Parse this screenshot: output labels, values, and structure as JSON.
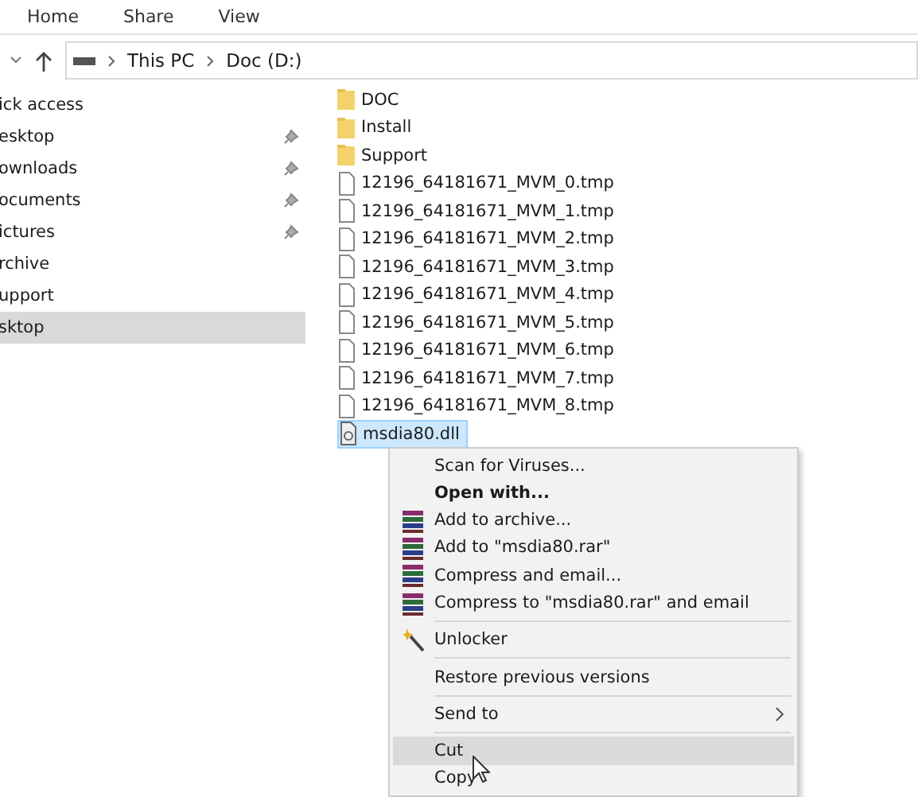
{
  "ribbon": {
    "tabs": [
      {
        "label": "Home",
        "selected": false
      },
      {
        "label": "Share",
        "selected": false
      },
      {
        "label": "View",
        "selected": false
      }
    ]
  },
  "address_bar": {
    "path": [
      "This PC",
      "Doc (D:)"
    ]
  },
  "navigation": {
    "items": [
      {
        "label": "ick access",
        "pinned": false,
        "selected": false
      },
      {
        "label": "esktop",
        "pinned": true,
        "selected": false
      },
      {
        "label": "ownloads",
        "pinned": true,
        "selected": false
      },
      {
        "label": "ocuments",
        "pinned": true,
        "selected": false
      },
      {
        "label": "ictures",
        "pinned": true,
        "selected": false
      },
      {
        "label": "rchive",
        "pinned": false,
        "selected": false
      },
      {
        "label": "upport",
        "pinned": false,
        "selected": false
      },
      {
        "label": "sktop",
        "pinned": false,
        "selected": true
      }
    ]
  },
  "files": [
    {
      "name": "DOC",
      "kind": "folder",
      "selected": false
    },
    {
      "name": "Install",
      "kind": "folder",
      "selected": false
    },
    {
      "name": "Support",
      "kind": "folder",
      "selected": false
    },
    {
      "name": "12196_64181671_MVM_0.tmp",
      "kind": "file",
      "selected": false
    },
    {
      "name": "12196_64181671_MVM_1.tmp",
      "kind": "file",
      "selected": false
    },
    {
      "name": "12196_64181671_MVM_2.tmp",
      "kind": "file",
      "selected": false
    },
    {
      "name": "12196_64181671_MVM_3.tmp",
      "kind": "file",
      "selected": false
    },
    {
      "name": "12196_64181671_MVM_4.tmp",
      "kind": "file",
      "selected": false
    },
    {
      "name": "12196_64181671_MVM_5.tmp",
      "kind": "file",
      "selected": false
    },
    {
      "name": "12196_64181671_MVM_6.tmp",
      "kind": "file",
      "selected": false
    },
    {
      "name": "12196_64181671_MVM_7.tmp",
      "kind": "file",
      "selected": false
    },
    {
      "name": "12196_64181671_MVM_8.tmp",
      "kind": "file",
      "selected": false
    },
    {
      "name": "msdia80.dll",
      "kind": "dll",
      "selected": true
    }
  ],
  "context_menu": {
    "items": [
      {
        "kind": "plain",
        "label": "Scan for Viruses...",
        "bold": false,
        "submenu": false,
        "selected": false
      },
      {
        "kind": "plain",
        "label": "Open with...",
        "bold": true,
        "submenu": false,
        "selected": false
      },
      {
        "kind": "archiver",
        "label": "Add to archive...",
        "bold": false,
        "submenu": false,
        "selected": false
      },
      {
        "kind": "archiver",
        "label": "Add to \"msdia80.rar\"",
        "bold": false,
        "submenu": false,
        "selected": false
      },
      {
        "kind": "archiver",
        "label": "Compress and email...",
        "bold": false,
        "submenu": false,
        "selected": false
      },
      {
        "kind": "archiver",
        "label": "Compress to \"msdia80.rar\" and email",
        "bold": false,
        "submenu": false,
        "selected": false
      },
      {
        "kind": "separator"
      },
      {
        "kind": "unlocker",
        "label": "Unlocker",
        "bold": false,
        "submenu": false,
        "selected": false
      },
      {
        "kind": "separator"
      },
      {
        "kind": "plain",
        "label": "Restore previous versions",
        "bold": false,
        "submenu": false,
        "selected": false
      },
      {
        "kind": "separator"
      },
      {
        "kind": "plain",
        "label": "Send to",
        "bold": false,
        "submenu": true,
        "selected": false
      },
      {
        "kind": "separator"
      },
      {
        "kind": "plain",
        "label": "Cut",
        "bold": false,
        "submenu": false,
        "selected": true
      },
      {
        "kind": "plain",
        "label": "Copy",
        "bold": false,
        "submenu": false,
        "selected": false
      }
    ]
  }
}
